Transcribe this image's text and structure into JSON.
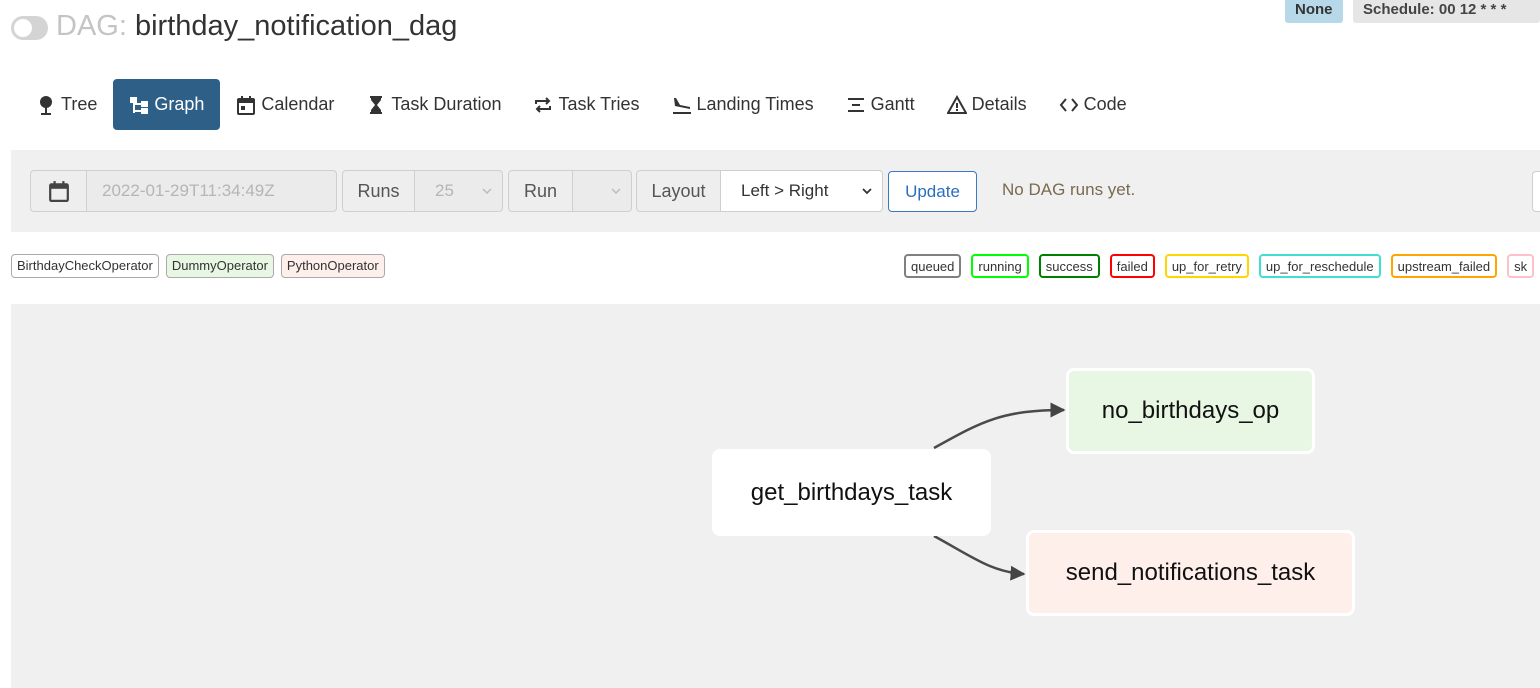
{
  "header": {
    "prefix": "DAG:",
    "dag_id": "birthday_notification_dag",
    "badge_none": "None",
    "schedule": "Schedule: 00 12 * * *"
  },
  "nav": {
    "tree": "Tree",
    "graph": "Graph",
    "calendar": "Calendar",
    "task_duration": "Task Duration",
    "task_tries": "Task Tries",
    "landing_times": "Landing Times",
    "gantt": "Gantt",
    "details": "Details",
    "code": "Code",
    "active": "Graph"
  },
  "toolbar": {
    "base_date": "2022-01-29T11:34:49Z",
    "runs_label": "Runs",
    "runs_value": "25",
    "run_label": "Run",
    "run_value": "",
    "layout_label": "Layout",
    "layout_value": "Left > Right",
    "update_label": "Update",
    "status_message": "No DAG runs yet."
  },
  "operators": [
    {
      "name": "BirthdayCheckOperator",
      "color": "#ffffff"
    },
    {
      "name": "DummyOperator",
      "color": "#e8f7e4"
    },
    {
      "name": "PythonOperator",
      "color": "#ffefeb"
    }
  ],
  "states": [
    {
      "name": "queued",
      "color": "#808080"
    },
    {
      "name": "running",
      "color": "#00ff00"
    },
    {
      "name": "success",
      "color": "#008000"
    },
    {
      "name": "failed",
      "color": "#ff0000"
    },
    {
      "name": "up_for_retry",
      "color": "#ffd700"
    },
    {
      "name": "up_for_reschedule",
      "color": "#40e0d0"
    },
    {
      "name": "upstream_failed",
      "color": "#ffa500"
    },
    {
      "name": "skipped",
      "label": "sk",
      "color": "#ffc0cb"
    }
  ],
  "graph": {
    "nodes": {
      "get_birthdays_task": {
        "label": "get_birthdays_task",
        "color": "#ffffff"
      },
      "no_birthdays_op": {
        "label": "no_birthdays_op",
        "color": "#e8f7e4"
      },
      "send_notifications_task": {
        "label": "send_notifications_task",
        "color": "#ffefeb"
      }
    },
    "edges": [
      {
        "from": "get_birthdays_task",
        "to": "no_birthdays_op"
      },
      {
        "from": "get_birthdays_task",
        "to": "send_notifications_task"
      }
    ]
  }
}
